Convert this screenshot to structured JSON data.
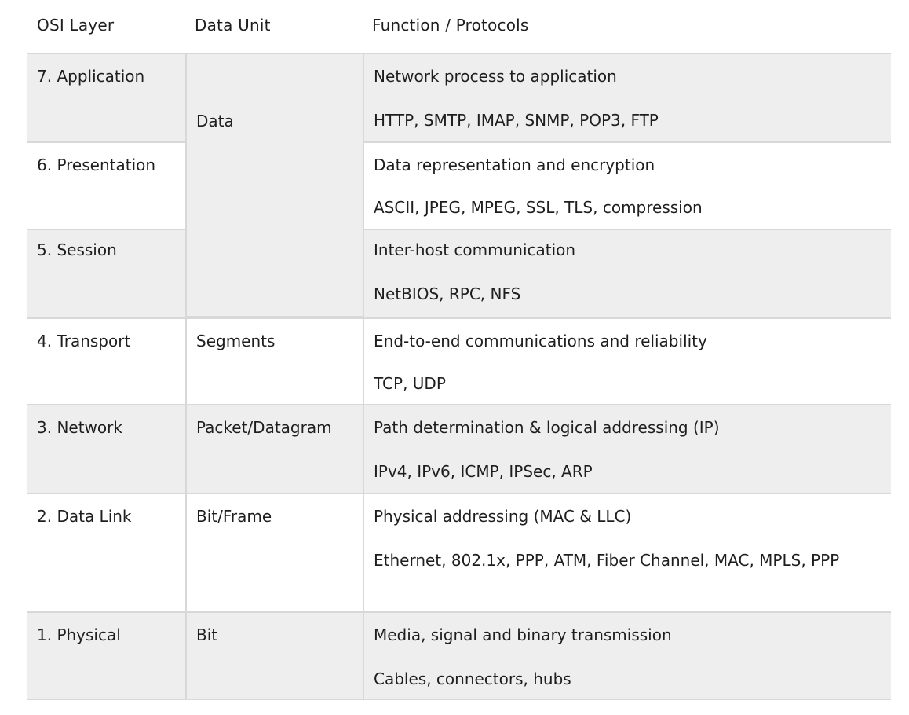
{
  "table": {
    "headers": {
      "layer": "OSI Layer",
      "data_unit": "Data Unit",
      "function": "Function / Protocols"
    },
    "rows": [
      {
        "layer": "7. Application",
        "data_unit": "Data",
        "function": "Network process to application",
        "protocols": "HTTP, SMTP, IMAP, SNMP, POP3, FTP"
      },
      {
        "layer": "6. Presentation",
        "data_unit": "",
        "function": "Data representation and encryption",
        "protocols": "ASCII, JPEG, MPEG, SSL, TLS, compression"
      },
      {
        "layer": "5. Session",
        "data_unit": "",
        "function": "Inter-host communication",
        "protocols": "NetBIOS, RPC, NFS"
      },
      {
        "layer": "4. Transport",
        "data_unit": "Segments",
        "function": "End-to-end communications and reliability",
        "protocols": "TCP, UDP"
      },
      {
        "layer": "3. Network",
        "data_unit": "Packet/Datagram",
        "function": "Path determination & logical addressing (IP)",
        "protocols": "IPv4, IPv6, ICMP, IPSec, ARP"
      },
      {
        "layer": "2. Data Link",
        "data_unit": "Bit/Frame",
        "function": "Physical addressing (MAC & LLC)",
        "protocols": "Ethernet, 802.1x, PPP, ATM, Fiber Channel, MAC, MPLS, PPP"
      },
      {
        "layer": "1. Physical",
        "data_unit": "Bit",
        "function": "Media, signal and binary transmission",
        "protocols": "Cables, connectors, hubs"
      }
    ]
  },
  "colors": {
    "shaded_row": "#eeeeee",
    "border": "#d8d8d8",
    "text": "#1e1e1e"
  }
}
